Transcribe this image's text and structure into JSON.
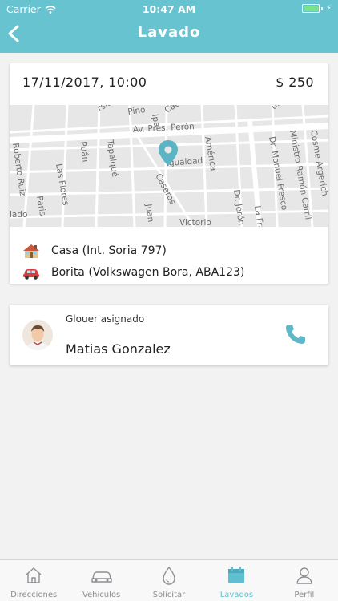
{
  "status_bar": {
    "carrier": "Carrier",
    "time": "10:47 AM"
  },
  "header": {
    "title": "Lavado",
    "back_icon": "chevron-left-icon"
  },
  "wash": {
    "datetime": "17/11/2017, 10:00",
    "price": "$ 250",
    "map_labels": [
      "Av. Pres. Perón",
      "Igualdad",
      "América",
      "Caseros",
      "Las Flores",
      "Puán",
      "Tapalqué",
      "Roberto Ruiz",
      "Paris",
      "Dr. Manuel Fresco",
      "Ministro Ramón Carril",
      "Cosme Argerich",
      "Dr. Jerón",
      "La Fra",
      "Juan",
      "Pino",
      "Ipa",
      "Cació",
      "rsis",
      "uni",
      "Victorio",
      "lado"
    ],
    "address_icon": "house-icon",
    "address": "Casa (Int. Soria 797)",
    "vehicle_icon": "car-icon",
    "vehicle": "Borita (Volkswagen Bora, ABA123)"
  },
  "assignee": {
    "label": "Glouer asignado",
    "name": "Matias Gonzalez",
    "call_icon": "phone-icon"
  },
  "tabs": [
    {
      "label": "Direcciones",
      "icon": "house-outline-icon",
      "active": false
    },
    {
      "label": "Vehiculos",
      "icon": "car-outline-icon",
      "active": false
    },
    {
      "label": "Solicitar",
      "icon": "drop-icon",
      "active": false
    },
    {
      "label": "Lavados",
      "icon": "calendar-icon",
      "active": true
    },
    {
      "label": "Perfil",
      "icon": "person-icon",
      "active": false
    }
  ],
  "colors": {
    "accent": "#66c3cf",
    "active_tab": "#5fbfd0",
    "pin": "#5ab4c4",
    "phone": "#5fb8c8"
  }
}
